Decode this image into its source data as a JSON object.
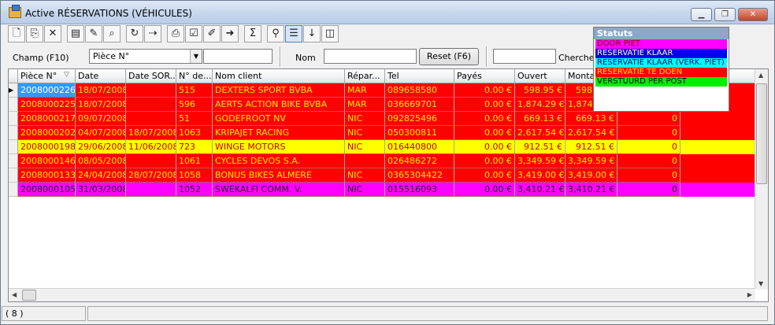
{
  "window": {
    "title": "Active RÉSERVATIONS (VÉHICULES)"
  },
  "toolbar": {
    "buttons": [
      {
        "name": "new-document-icon",
        "glyph": "🗋"
      },
      {
        "name": "copy-document-icon",
        "glyph": "⎘"
      },
      {
        "name": "delete-icon",
        "glyph": "✕"
      },
      {
        "name": "properties-icon",
        "glyph": "▤"
      },
      {
        "name": "pen-icon",
        "glyph": "✎"
      },
      {
        "name": "binoculars-icon",
        "glyph": "⌕"
      },
      {
        "name": "refresh-icon",
        "glyph": "↻"
      },
      {
        "name": "transfer-icon",
        "glyph": "⇢"
      },
      {
        "name": "print-icon",
        "glyph": "⎙"
      },
      {
        "name": "check-icon",
        "glyph": "☑"
      },
      {
        "name": "edit-document-icon",
        "glyph": "✐"
      },
      {
        "name": "export-icon",
        "glyph": "➜"
      },
      {
        "name": "sum-icon",
        "glyph": "Σ"
      },
      {
        "name": "search-key-icon",
        "glyph": "⚲"
      },
      {
        "name": "list-view-icon",
        "glyph": "☰"
      },
      {
        "name": "sort-az-icon",
        "glyph": "↓"
      },
      {
        "name": "columns-icon",
        "glyph": "◫"
      }
    ]
  },
  "filter": {
    "field_label": "Champ (F10)",
    "field_value": "Pièce N°",
    "name_label": "Nom",
    "reset_label": "Reset (F6)",
    "search_label": "Chercher"
  },
  "grid": {
    "columns": [
      "Pièce N°",
      "Date",
      "Date SOR...",
      "N° de...",
      "Nom client",
      "Répar...",
      "Tel",
      "Payés",
      "Ouvert",
      "Montant",
      ""
    ],
    "rows": [
      {
        "piece": "2008000226",
        "date": "18/07/2008",
        "date_sortie": "",
        "numero": "515",
        "client": "DEXTERS SPORT BVBA",
        "repar": "MAR",
        "tel": "089658580",
        "payes": "0.00 €",
        "ouvert": "598.95 €",
        "montant": "598.95 €",
        "extra": "0",
        "bg": "#ff0000",
        "fg": "#ffe800"
      },
      {
        "piece": "2008000225",
        "date": "18/07/2008",
        "date_sortie": "",
        "numero": "596",
        "client": "AERTS ACTION BIKE BVBA",
        "repar": "MAR",
        "tel": "036669701",
        "payes": "0.00 €",
        "ouvert": "1,874.29 €",
        "montant": "1,874.29 €",
        "extra": "0",
        "bg": "#ff0000",
        "fg": "#ffe800"
      },
      {
        "piece": "2008000217",
        "date": "09/07/2008",
        "date_sortie": "",
        "numero": "51",
        "client": "GODEFROOT NV",
        "repar": "NIC",
        "tel": "092825496",
        "payes": "0.00 €",
        "ouvert": "669.13 €",
        "montant": "669.13 €",
        "extra": "0",
        "bg": "#ff0000",
        "fg": "#ffe800"
      },
      {
        "piece": "2008000202",
        "date": "04/07/2008",
        "date_sortie": "18/07/2008",
        "numero": "1063",
        "client": "KRIPAJET RACING",
        "repar": "NIC",
        "tel": "050300811",
        "payes": "0.00 €",
        "ouvert": "2,617.54 €",
        "montant": "2,617.54 €",
        "extra": "0",
        "bg": "#ff0000",
        "fg": "#ffe800"
      },
      {
        "piece": "2008000198",
        "date": "29/06/2008",
        "date_sortie": "11/06/2008",
        "numero": "723",
        "client": "WINGE MOTORS",
        "repar": "NIC",
        "tel": "016440800",
        "payes": "0.00 €",
        "ouvert": "912.51 €",
        "montant": "912.51 €",
        "extra": "0",
        "bg": "#ffff00",
        "fg": "#cc0000"
      },
      {
        "piece": "2008000146",
        "date": "08/05/2008",
        "date_sortie": "",
        "numero": "1061",
        "client": "CYCLES DEVOS S.A.",
        "repar": "",
        "tel": "026486272",
        "payes": "0.00 €",
        "ouvert": "3,349.59 €",
        "montant": "3,349.59 €",
        "extra": "0",
        "bg": "#ff0000",
        "fg": "#ffe800"
      },
      {
        "piece": "2008000133",
        "date": "24/04/2008",
        "date_sortie": "28/07/2008",
        "numero": "1058",
        "client": "BONUS BIKES ALMERE",
        "repar": "NIC",
        "tel": "0365304422",
        "payes": "0.00 €",
        "ouvert": "3,419.00 €",
        "montant": "3,419.00 €",
        "extra": "0",
        "bg": "#ff0000",
        "fg": "#ffe800"
      },
      {
        "piece": "2008000105",
        "date": "31/03/2008",
        "date_sortie": "",
        "numero": "1052",
        "client": "SWEKALFI COMM. V.",
        "repar": "NIC",
        "tel": "015516093",
        "payes": "0.00 €",
        "ouvert": "3,410.21 €",
        "montant": "3,410.21 €",
        "extra": "0",
        "bg": "#ff00ff",
        "fg": "#222222"
      }
    ]
  },
  "legend": {
    "title": "Statuts",
    "items": [
      {
        "label": "DOOR PIET",
        "bg": "#ff00ff",
        "fg": "#7a0000"
      },
      {
        "label": "RESERVATIE KLAAR",
        "bg": "#0000ee",
        "fg": "#ffffff"
      },
      {
        "label": "RESERVATIE KLAAR (VERK. PIET)",
        "bg": "#00ffff",
        "fg": "#000080"
      },
      {
        "label": "RESERVATIE TE DOEN",
        "bg": "#ff0000",
        "fg": "#ffe800"
      },
      {
        "label": "VERSTUURD PER POST",
        "bg": "#00ee00",
        "fg": "#000000"
      }
    ]
  },
  "status": {
    "count": "( 8 )"
  }
}
